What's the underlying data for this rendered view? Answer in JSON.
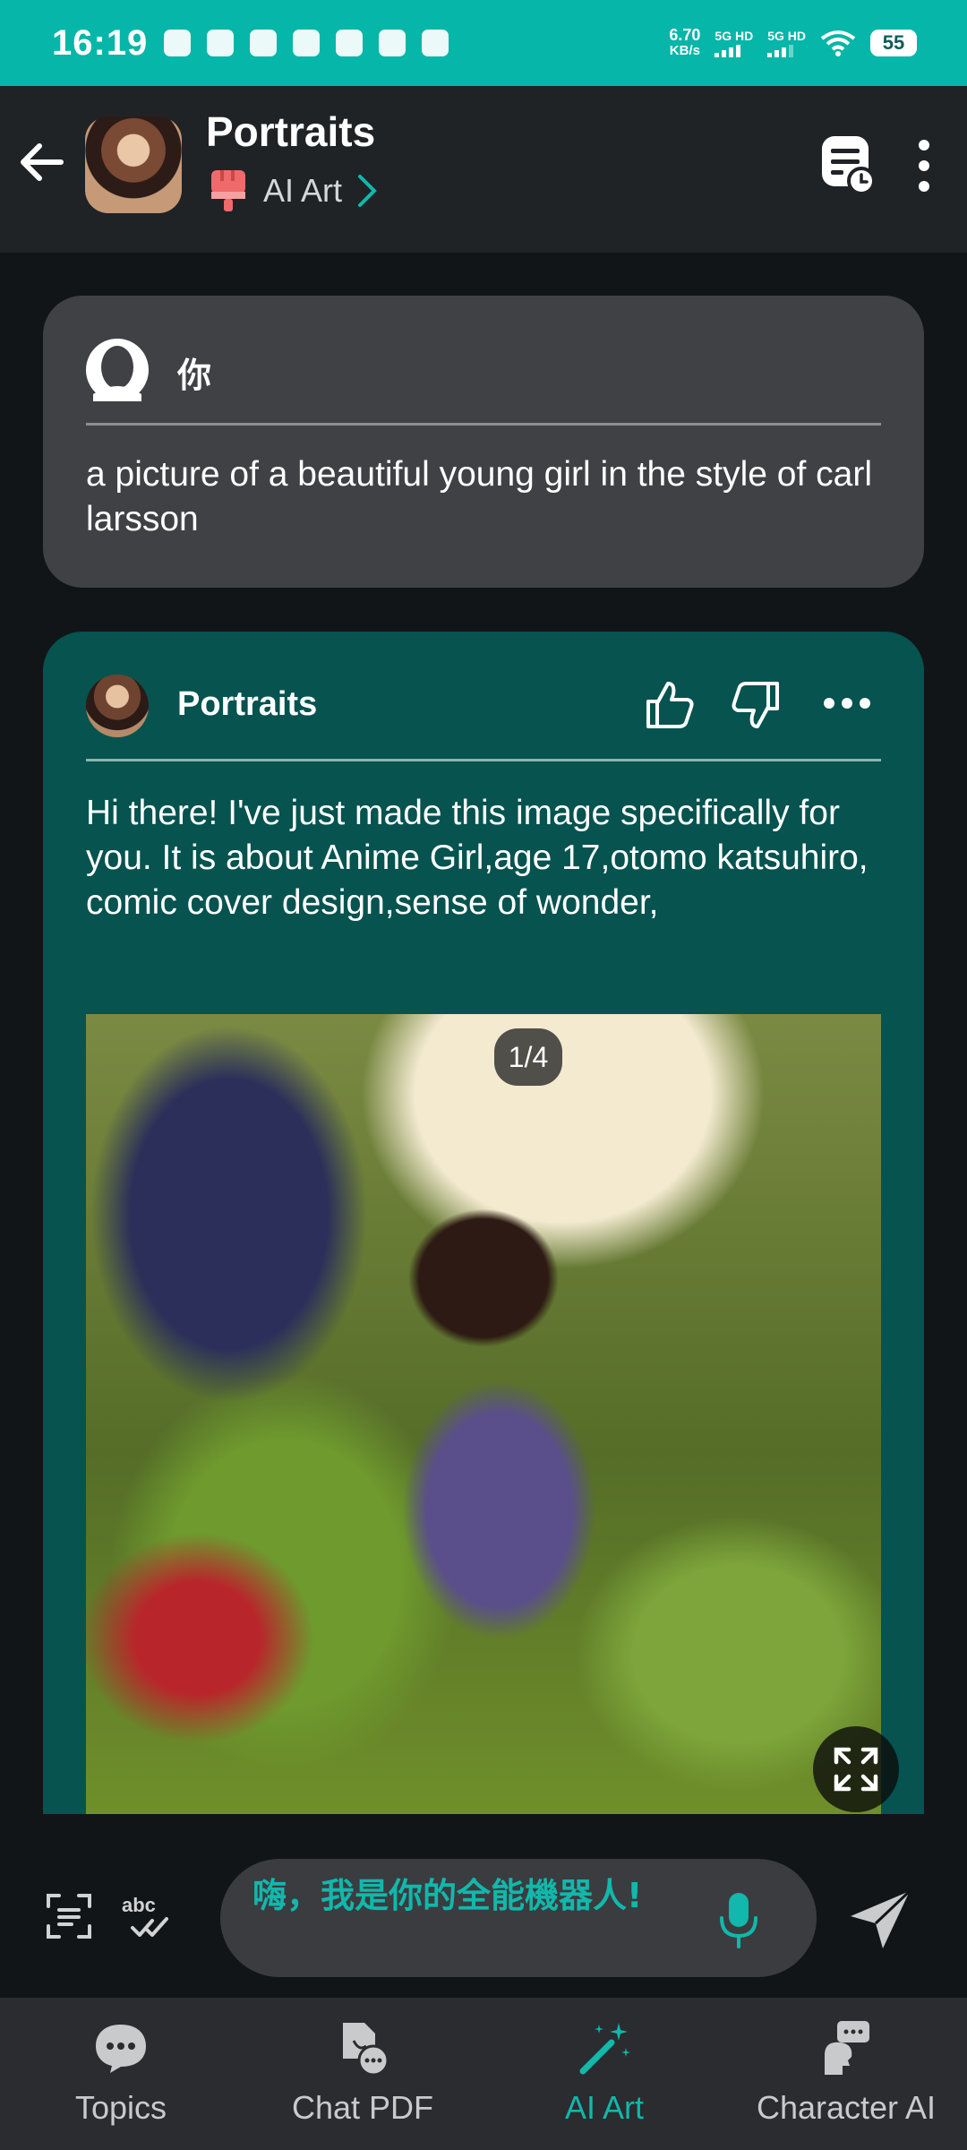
{
  "status_bar": {
    "time": "16:19",
    "net_speed_value": "6.70",
    "net_speed_unit": "KB/s",
    "sim1": "5G HD",
    "sim2": "5G HD",
    "battery": "55"
  },
  "header": {
    "title": "Portraits",
    "subtitle": "AI Art"
  },
  "user_message": {
    "sender": "你",
    "text": "a picture of a beautiful young girl in the style of carl larsson"
  },
  "bot_message": {
    "sender": "Portraits",
    "text": "Hi there! I've just made this image specifically for you. It is about Anime Girl,age 17,otomo katsuhiro, comic cover design,sense of wonder,",
    "image_counter": "1/4"
  },
  "input": {
    "placeholder": "嗨，我是你的全能機器人!"
  },
  "bottom_nav": {
    "items": [
      {
        "label": "Topics",
        "icon": "chat-bubble-icon"
      },
      {
        "label": "Chat PDF",
        "icon": "pdf-chat-icon"
      },
      {
        "label": "AI Art",
        "icon": "magic-wand-icon"
      },
      {
        "label": "Character AI",
        "icon": "character-icon"
      }
    ],
    "active_index": 2
  },
  "colors": {
    "accent": "#11b8ab",
    "status_bar": "#06b6a8",
    "bot_bubble": "#06534f",
    "user_bubble": "#3f4144"
  }
}
